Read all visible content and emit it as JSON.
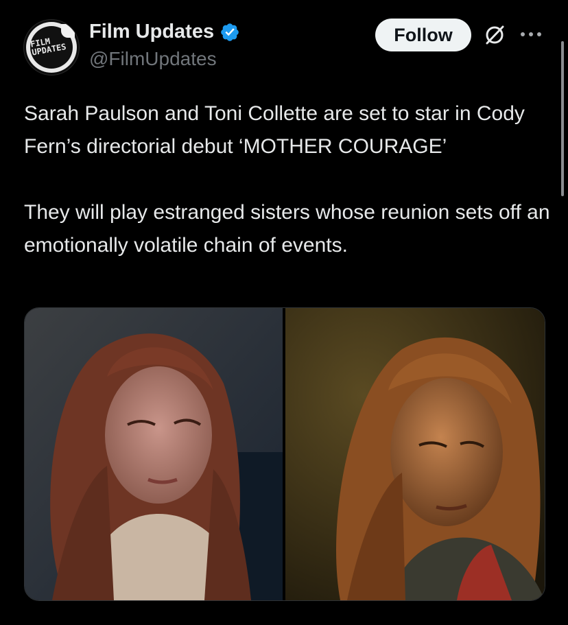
{
  "account": {
    "name": "Film Updates",
    "handle": "@FilmUpdates",
    "avatar_text_line1": "FILM",
    "avatar_text_line2": "UPDATES",
    "verified": true
  },
  "actions": {
    "follow_label": "Follow",
    "grok_icon": "grok-icon",
    "more_icon": "more-options-icon"
  },
  "tweet": {
    "paragraph1": "Sarah Paulson and Toni Collette are set to star in Cody Fern’s directorial debut ‘MOTHER COURAGE’",
    "paragraph2": "They will play estranged sisters whose reunion sets off an emotionally volatile chain of events."
  },
  "media": {
    "photos": [
      "photo-left",
      "photo-right"
    ]
  },
  "colors": {
    "background": "#000000",
    "text": "#e7e9ea",
    "secondary_text": "#71767b",
    "verified_blue": "#1d9bf0",
    "button_bg": "#eff3f4"
  }
}
